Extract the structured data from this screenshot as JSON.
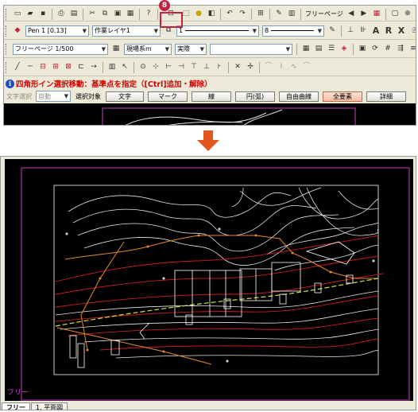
{
  "callout": {
    "number": "8"
  },
  "toolbar1": {
    "page_selector": "フリーページ",
    "buttons": [
      "new-icon",
      "open-icon",
      "save-icon",
      "print-icon",
      "preview-icon",
      "cut-icon",
      "copy-icon",
      "paste-icon",
      "delete-icon",
      "help-icon",
      "select-window-icon",
      "select-icon",
      "bulb-icon",
      "snap-icon",
      "undo-icon",
      "redo-icon",
      "layer-icon",
      "edit-icon",
      "property-icon"
    ]
  },
  "toolbar2": {
    "pen": "Pen 1 [0.13]",
    "layer": "作業レイヤ1",
    "linetype": "1",
    "width": "8"
  },
  "toolbar3": {
    "page": "フリーページ 1/500",
    "coord_system": "現場系m",
    "unit": "実際"
  },
  "status": {
    "text": "四角形イン選択移動：基準点を指定（[Ctrl]追加・解除）"
  },
  "filter": {
    "selection_label": "文字選択",
    "selection_mode": "自動",
    "target_label": "選択対象",
    "buttons": [
      "文字",
      "マーク",
      "線",
      "円(弧)",
      "自由曲線",
      "全要素",
      "詳細"
    ],
    "active_button": "全要素"
  },
  "drawing": {
    "frame_label": "フリー"
  },
  "sheet_tabs": [
    "フリー",
    "1. 平面図"
  ],
  "colors": {
    "callout": "#c2213f",
    "arrow": "#e2561f",
    "frame": "#c23fc9",
    "status": "#d40000"
  }
}
